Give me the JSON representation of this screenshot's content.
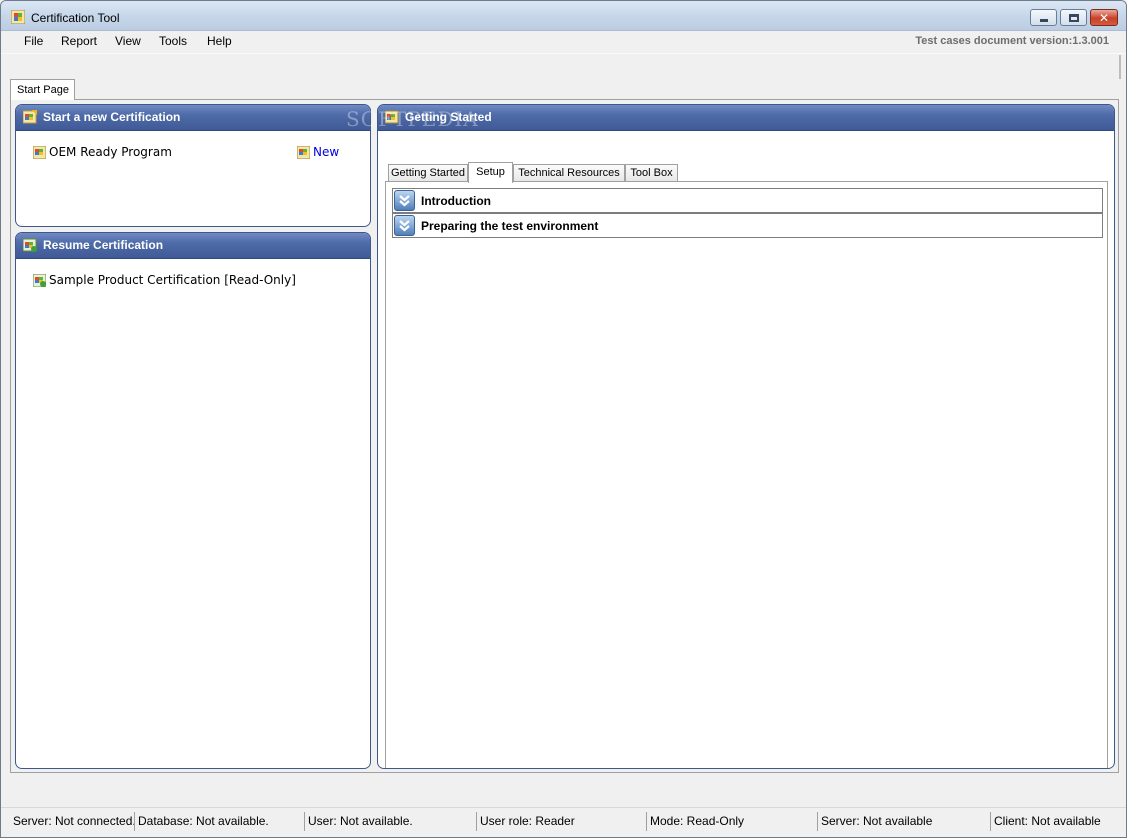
{
  "window": {
    "title": "Certification Tool",
    "close_glyph": "✕"
  },
  "menu": {
    "items": [
      "File",
      "Report",
      "View",
      "Tools",
      "Help"
    ],
    "version_text": "Test cases document version:1.3.001"
  },
  "document_tab": "Start Page",
  "start_panel": {
    "title": "Start a new Certification",
    "program_label": "OEM Ready Program",
    "new_link": "New"
  },
  "resume_panel": {
    "title": "Resume Certification",
    "item_label": "Sample Product Certification [Read-Only]"
  },
  "getting_started_panel": {
    "title": "Getting Started",
    "tabs": [
      "Getting Started",
      "Setup",
      "Technical Resources",
      "Tool Box"
    ],
    "active_tab": "Setup",
    "sections": [
      "Introduction",
      "Preparing the test environment"
    ]
  },
  "watermark": "SOFTPEDIA",
  "status_bar": [
    "Server: Not connected.",
    "Database: Not available.",
    "User: Not available.",
    "User role: Reader",
    "Mode: Read-Only",
    "Server: Not available",
    "Client: Not available"
  ],
  "colors": {
    "panel_header": "#4f6ba8",
    "link": "#0000e0",
    "version_text": "#6d6d6d"
  }
}
